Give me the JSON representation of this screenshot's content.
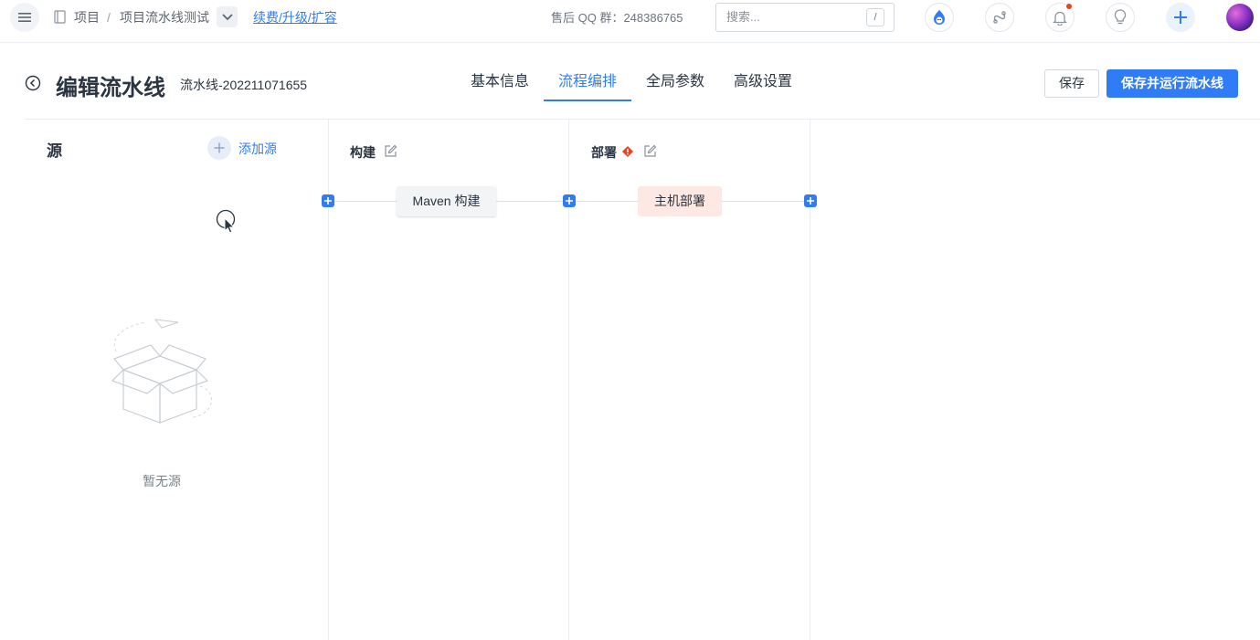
{
  "topbar": {
    "breadcrumb": {
      "project": "项目",
      "separator": "/",
      "pipeline": "项目流水线测试",
      "renew_link": "续费/升级/扩容"
    },
    "qq_group": "售后 QQ 群：248386765",
    "search": {
      "placeholder": "搜索...",
      "shortcut": "/"
    },
    "icons": [
      "menu-icon",
      "repo-icon",
      "chevron-down-icon",
      "mascot-icon",
      "link-icon",
      "bell-icon",
      "bulb-icon",
      "plus-icon",
      "avatar"
    ],
    "accent_color": "#2f7cf6"
  },
  "header": {
    "title": "编辑流水线",
    "pipeline_name": "流水线-202211071655",
    "tabs": [
      {
        "label": "基本信息",
        "active": false
      },
      {
        "label": "流程编排",
        "active": true
      },
      {
        "label": "全局参数",
        "active": false
      },
      {
        "label": "高级设置",
        "active": false
      }
    ],
    "save_label": "保存",
    "save_run_label": "保存并运行流水线"
  },
  "source": {
    "title": "源",
    "add_label": "添加源",
    "empty_label": "暂无源"
  },
  "stages": [
    {
      "name": "构建",
      "jobs": [
        {
          "label": "Maven 构建",
          "status": "normal"
        }
      ]
    },
    {
      "name": "部署",
      "has_warning": true,
      "jobs": [
        {
          "label": "主机部署",
          "status": "error"
        }
      ]
    }
  ],
  "colors": {
    "warning": "#e8421f",
    "error_job_bg": "#fde8e4"
  }
}
